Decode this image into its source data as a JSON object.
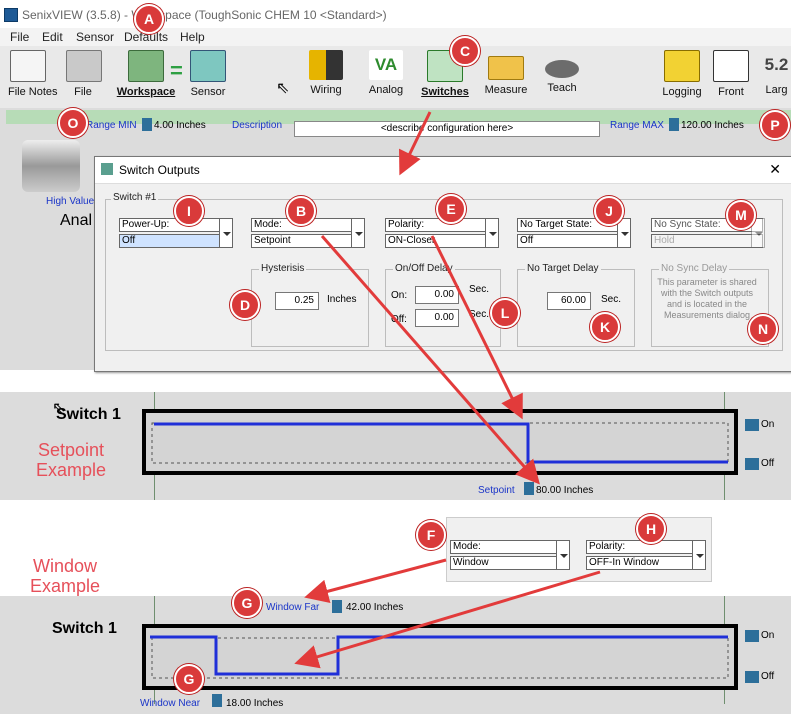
{
  "window": {
    "title": "SenixVIEW (3.5.8) - Workspace (ToughSonic CHEM 10 <Standard>)"
  },
  "menu": [
    "File",
    "Edit",
    "Sensor",
    "Defaults",
    "Help"
  ],
  "toolbar": {
    "file_notes": "File Notes",
    "file": "File",
    "workspace": "Workspace",
    "sensor": "Sensor",
    "wiring": "Wiring",
    "analog": "Analog",
    "analog_icon_text": "VA",
    "switches": "Switches",
    "measure": "Measure",
    "teach": "Teach",
    "logging": "Logging",
    "front": "Front",
    "large": "Larg",
    "version_icon": "5.2"
  },
  "workspace": {
    "range_min_label": "Range MIN",
    "range_min_value": "4.00 Inches",
    "description_label": "Description",
    "description_placeholder": "<describe configuration here>",
    "range_max_label": "Range MAX",
    "range_max_value": "120.00 Inches",
    "high_value": "High Value",
    "anal_label": "Anal"
  },
  "dialog": {
    "title": "Switch Outputs",
    "close": "✕",
    "group": "Switch #1",
    "power_up": {
      "label": "Power-Up:",
      "value": "Off"
    },
    "mode": {
      "label": "Mode:",
      "value": "Setpoint"
    },
    "polarity": {
      "label": "Polarity:",
      "value": "ON-Closer"
    },
    "no_target_state": {
      "label": "No Target State:",
      "value": "Off"
    },
    "no_sync_state": {
      "label": "No Sync State:",
      "value": "Hold"
    },
    "hysteresis": {
      "title": "Hysterisis",
      "value": "0.25",
      "unit": "Inches"
    },
    "onoff_delay": {
      "title": "On/Off Delay",
      "on_label": "On:",
      "on_value": "0.00",
      "off_label": "Off:",
      "off_value": "0.00",
      "unit": "Sec."
    },
    "no_target_delay": {
      "title": "No Target Delay",
      "value": "60.00",
      "unit": "Sec."
    },
    "no_sync_delay": {
      "title": "No Sync Delay",
      "text": "This parameter is shared with the Switch outputs and is located in the Measurements dialog"
    }
  },
  "setpoint_example": {
    "switch_label": "Switch 1",
    "caption_line1": "Setpoint",
    "caption_line2": "Example",
    "on": "On",
    "off": "Off",
    "setpoint_label": "Setpoint",
    "setpoint_value": "80.00 Inches"
  },
  "window_example": {
    "caption_line1": "Window",
    "caption_line2": "Example",
    "mode": {
      "label": "Mode:",
      "value": "Window"
    },
    "polarity": {
      "label": "Polarity:",
      "value": "OFF-In Window"
    },
    "window_far_label": "Window Far",
    "window_far_value": "42.00 Inches",
    "switch_label": "Switch 1",
    "on": "On",
    "off": "Off",
    "window_near_label": "Window Near",
    "window_near_value": "18.00 Inches"
  },
  "badges": [
    "A",
    "B",
    "C",
    "D",
    "E",
    "F",
    "G",
    "G",
    "H",
    "I",
    "J",
    "K",
    "L",
    "M",
    "N",
    "O",
    "P"
  ],
  "colors": {
    "badge": "#d93a3a",
    "signal": "#1f2fd8",
    "accent_red": "#e6505a",
    "marker": "#2d6f9a"
  }
}
